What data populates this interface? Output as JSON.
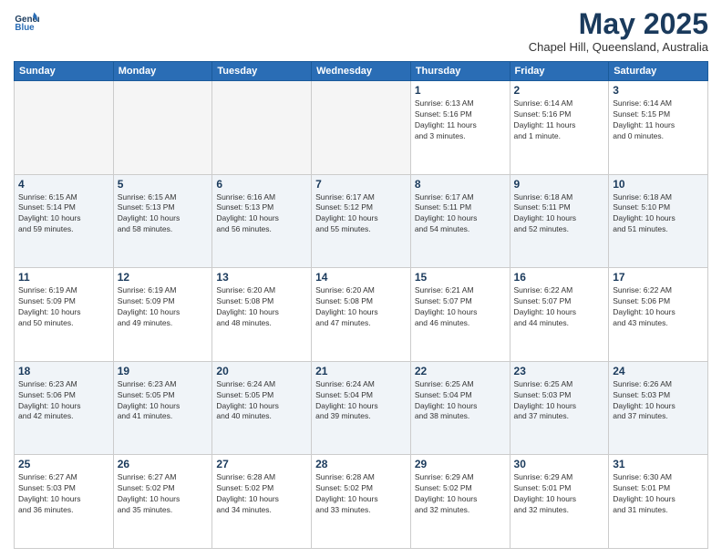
{
  "header": {
    "logo_line1": "General",
    "logo_line2": "Blue",
    "month": "May 2025",
    "location": "Chapel Hill, Queensland, Australia"
  },
  "weekdays": [
    "Sunday",
    "Monday",
    "Tuesday",
    "Wednesday",
    "Thursday",
    "Friday",
    "Saturday"
  ],
  "weeks": [
    [
      {
        "day": "",
        "info": ""
      },
      {
        "day": "",
        "info": ""
      },
      {
        "day": "",
        "info": ""
      },
      {
        "day": "",
        "info": ""
      },
      {
        "day": "1",
        "info": "Sunrise: 6:13 AM\nSunset: 5:16 PM\nDaylight: 11 hours\nand 3 minutes."
      },
      {
        "day": "2",
        "info": "Sunrise: 6:14 AM\nSunset: 5:16 PM\nDaylight: 11 hours\nand 1 minute."
      },
      {
        "day": "3",
        "info": "Sunrise: 6:14 AM\nSunset: 5:15 PM\nDaylight: 11 hours\nand 0 minutes."
      }
    ],
    [
      {
        "day": "4",
        "info": "Sunrise: 6:15 AM\nSunset: 5:14 PM\nDaylight: 10 hours\nand 59 minutes."
      },
      {
        "day": "5",
        "info": "Sunrise: 6:15 AM\nSunset: 5:13 PM\nDaylight: 10 hours\nand 58 minutes."
      },
      {
        "day": "6",
        "info": "Sunrise: 6:16 AM\nSunset: 5:13 PM\nDaylight: 10 hours\nand 56 minutes."
      },
      {
        "day": "7",
        "info": "Sunrise: 6:17 AM\nSunset: 5:12 PM\nDaylight: 10 hours\nand 55 minutes."
      },
      {
        "day": "8",
        "info": "Sunrise: 6:17 AM\nSunset: 5:11 PM\nDaylight: 10 hours\nand 54 minutes."
      },
      {
        "day": "9",
        "info": "Sunrise: 6:18 AM\nSunset: 5:11 PM\nDaylight: 10 hours\nand 52 minutes."
      },
      {
        "day": "10",
        "info": "Sunrise: 6:18 AM\nSunset: 5:10 PM\nDaylight: 10 hours\nand 51 minutes."
      }
    ],
    [
      {
        "day": "11",
        "info": "Sunrise: 6:19 AM\nSunset: 5:09 PM\nDaylight: 10 hours\nand 50 minutes."
      },
      {
        "day": "12",
        "info": "Sunrise: 6:19 AM\nSunset: 5:09 PM\nDaylight: 10 hours\nand 49 minutes."
      },
      {
        "day": "13",
        "info": "Sunrise: 6:20 AM\nSunset: 5:08 PM\nDaylight: 10 hours\nand 48 minutes."
      },
      {
        "day": "14",
        "info": "Sunrise: 6:20 AM\nSunset: 5:08 PM\nDaylight: 10 hours\nand 47 minutes."
      },
      {
        "day": "15",
        "info": "Sunrise: 6:21 AM\nSunset: 5:07 PM\nDaylight: 10 hours\nand 46 minutes."
      },
      {
        "day": "16",
        "info": "Sunrise: 6:22 AM\nSunset: 5:07 PM\nDaylight: 10 hours\nand 44 minutes."
      },
      {
        "day": "17",
        "info": "Sunrise: 6:22 AM\nSunset: 5:06 PM\nDaylight: 10 hours\nand 43 minutes."
      }
    ],
    [
      {
        "day": "18",
        "info": "Sunrise: 6:23 AM\nSunset: 5:06 PM\nDaylight: 10 hours\nand 42 minutes."
      },
      {
        "day": "19",
        "info": "Sunrise: 6:23 AM\nSunset: 5:05 PM\nDaylight: 10 hours\nand 41 minutes."
      },
      {
        "day": "20",
        "info": "Sunrise: 6:24 AM\nSunset: 5:05 PM\nDaylight: 10 hours\nand 40 minutes."
      },
      {
        "day": "21",
        "info": "Sunrise: 6:24 AM\nSunset: 5:04 PM\nDaylight: 10 hours\nand 39 minutes."
      },
      {
        "day": "22",
        "info": "Sunrise: 6:25 AM\nSunset: 5:04 PM\nDaylight: 10 hours\nand 38 minutes."
      },
      {
        "day": "23",
        "info": "Sunrise: 6:25 AM\nSunset: 5:03 PM\nDaylight: 10 hours\nand 37 minutes."
      },
      {
        "day": "24",
        "info": "Sunrise: 6:26 AM\nSunset: 5:03 PM\nDaylight: 10 hours\nand 37 minutes."
      }
    ],
    [
      {
        "day": "25",
        "info": "Sunrise: 6:27 AM\nSunset: 5:03 PM\nDaylight: 10 hours\nand 36 minutes."
      },
      {
        "day": "26",
        "info": "Sunrise: 6:27 AM\nSunset: 5:02 PM\nDaylight: 10 hours\nand 35 minutes."
      },
      {
        "day": "27",
        "info": "Sunrise: 6:28 AM\nSunset: 5:02 PM\nDaylight: 10 hours\nand 34 minutes."
      },
      {
        "day": "28",
        "info": "Sunrise: 6:28 AM\nSunset: 5:02 PM\nDaylight: 10 hours\nand 33 minutes."
      },
      {
        "day": "29",
        "info": "Sunrise: 6:29 AM\nSunset: 5:02 PM\nDaylight: 10 hours\nand 32 minutes."
      },
      {
        "day": "30",
        "info": "Sunrise: 6:29 AM\nSunset: 5:01 PM\nDaylight: 10 hours\nand 32 minutes."
      },
      {
        "day": "31",
        "info": "Sunrise: 6:30 AM\nSunset: 5:01 PM\nDaylight: 10 hours\nand 31 minutes."
      }
    ]
  ]
}
